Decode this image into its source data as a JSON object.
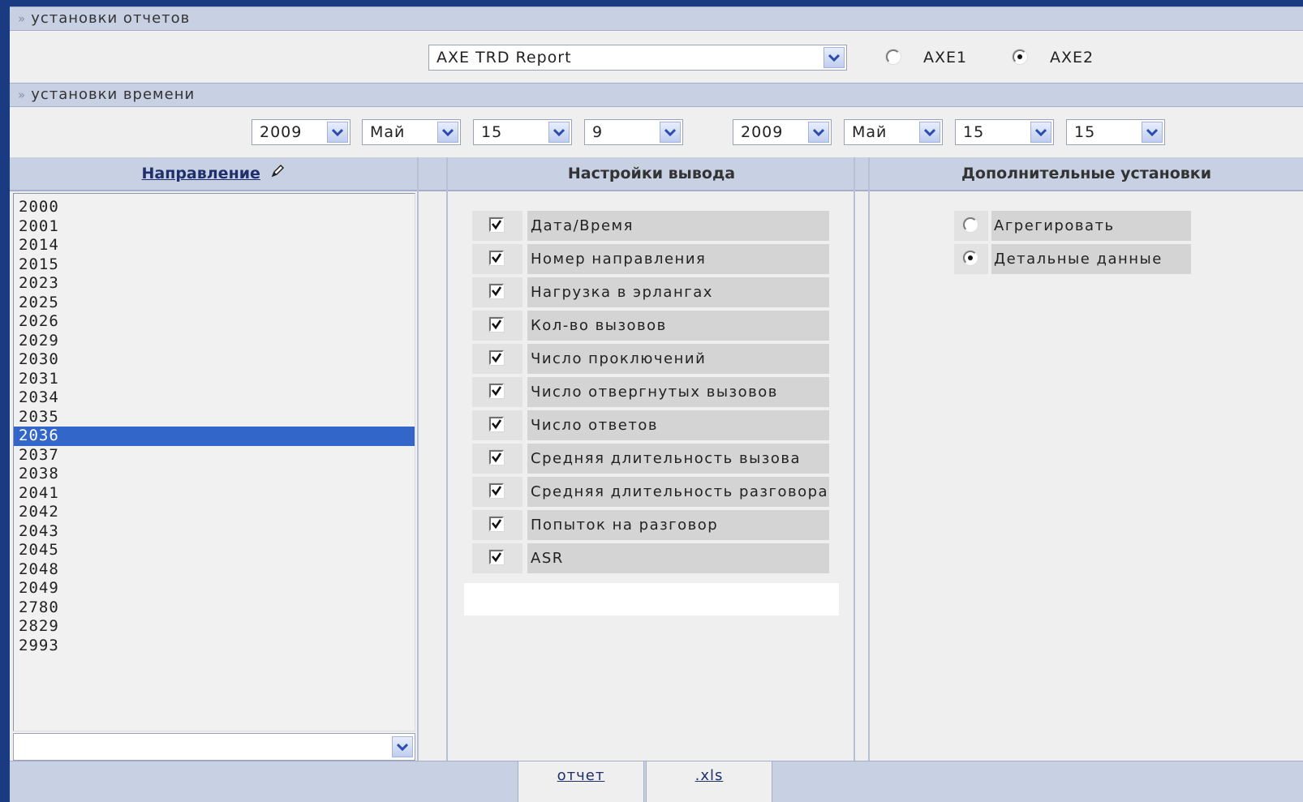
{
  "report_settings": {
    "header": "установки отчетов",
    "report_select": "AXE TRD Report",
    "radio_options": [
      {
        "label": "AXE1",
        "checked": false
      },
      {
        "label": "AXE2",
        "checked": true
      }
    ]
  },
  "time_settings": {
    "header": "установки времени",
    "start": {
      "year": "2009",
      "month": "Май",
      "day": "15",
      "hour": "9"
    },
    "end": {
      "year": "2009",
      "month": "Май",
      "day": "15",
      "hour": "15"
    }
  },
  "columns": {
    "direction": "Направление",
    "output": "Настройки вывода",
    "additional": "Дополнительные установки"
  },
  "direction_list": {
    "items": [
      "2000",
      "2001",
      "2014",
      "2015",
      "2023",
      "2025",
      "2026",
      "2029",
      "2030",
      "2031",
      "2034",
      "2035",
      "2036",
      "2037",
      "2038",
      "2041",
      "2042",
      "2043",
      "2045",
      "2048",
      "2049",
      "2780",
      "2829",
      "2993"
    ],
    "selected": "2036",
    "filter_select": ""
  },
  "output_options": [
    {
      "label": "Дата/Время",
      "checked": true
    },
    {
      "label": "Номер направления",
      "checked": true
    },
    {
      "label": "Нагрузка в эрлангах",
      "checked": true
    },
    {
      "label": "Кол-во вызовов",
      "checked": true
    },
    {
      "label": "Число проключений",
      "checked": true
    },
    {
      "label": "Число отвергнутых вызовов",
      "checked": true
    },
    {
      "label": "Число ответов",
      "checked": true
    },
    {
      "label": "Средняя длительность вызова",
      "checked": true
    },
    {
      "label": "Средняя длительность разговора",
      "checked": true
    },
    {
      "label": "Попыток на разговор",
      "checked": true
    },
    {
      "label": "ASR",
      "checked": true
    }
  ],
  "additional_options": [
    {
      "label": "Агрегировать",
      "checked": false
    },
    {
      "label": "Детальные данные",
      "checked": true
    }
  ],
  "footer": {
    "report_link": "отчет",
    "xls_link": ".xls"
  },
  "colors": {
    "background": "#1a3a82",
    "header": "#c8d1e3",
    "selection": "#3266c8"
  }
}
